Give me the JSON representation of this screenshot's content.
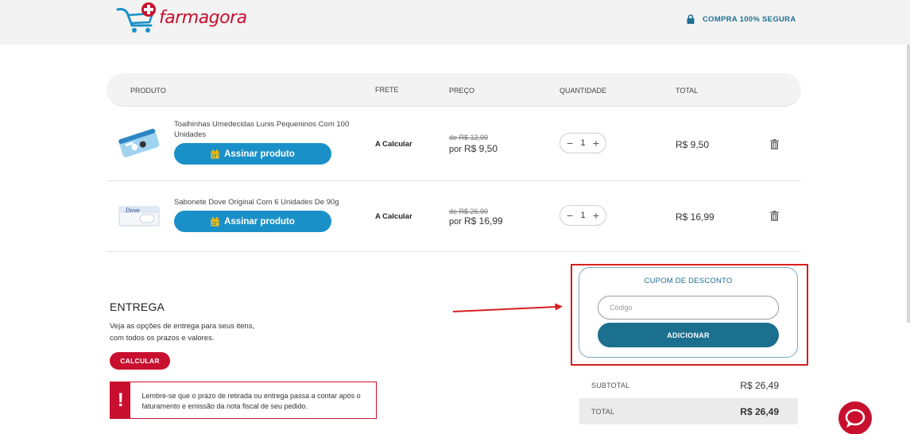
{
  "header": {
    "logo_text": "farmagora",
    "secure_label": "COMPRA 100% SEGURA"
  },
  "table": {
    "columns": {
      "produto": "PRODUTO",
      "frete": "FRETE",
      "preco": "PREÇO",
      "quantidade": "QUANTIDADE",
      "total": "TOTAL"
    },
    "items": [
      {
        "name": "Toalhinhas Umedecidas Lunis Pequeninos Com 100 Unidades",
        "subscribe_label": "Assinar produto",
        "frete": "A Calcular",
        "price_old": "de R$ 12,99",
        "price_prefix": "por",
        "price_new": "R$ 9,50",
        "quantity": "1",
        "total": "R$ 9,50"
      },
      {
        "name": "Sabonete Dove Original Com 6 Unidades De 90g",
        "subscribe_label": "Assinar produto",
        "frete": "A Calcular",
        "price_old": "de R$ 26,90",
        "price_prefix": "por",
        "price_new": "R$ 16,99",
        "quantity": "1",
        "total": "R$ 16,99"
      }
    ]
  },
  "entrega": {
    "title": "ENTREGA",
    "description": "Veja as opções de entrega para seus itens, com todos os prazos e valores.",
    "button": "CALCULAR",
    "notice_mark": "!",
    "notice": "Lembre-se que o prazo de retirada ou entrega passa a contar após o faturamento e emissão da nota fiscal de seu pedido."
  },
  "coupon": {
    "title": "CUPOM DE DESCONTO",
    "placeholder": "Código",
    "button": "ADICIONAR"
  },
  "summary": {
    "subtotal_label": "SUBTOTAL",
    "subtotal_value": "R$ 26,49",
    "total_label": "TOTAL",
    "total_value": "R$ 26,49"
  },
  "colors": {
    "brand_red": "#c8102e",
    "brand_blue": "#1d6f93",
    "subscribe_blue": "#1a90c8",
    "highlight_red": "#d81e1e"
  },
  "icons": [
    "cart-logo-icon",
    "lock-icon",
    "calendar-icon",
    "minus-icon",
    "plus-icon",
    "trash-icon",
    "arrow-icon",
    "chat-icon"
  ]
}
